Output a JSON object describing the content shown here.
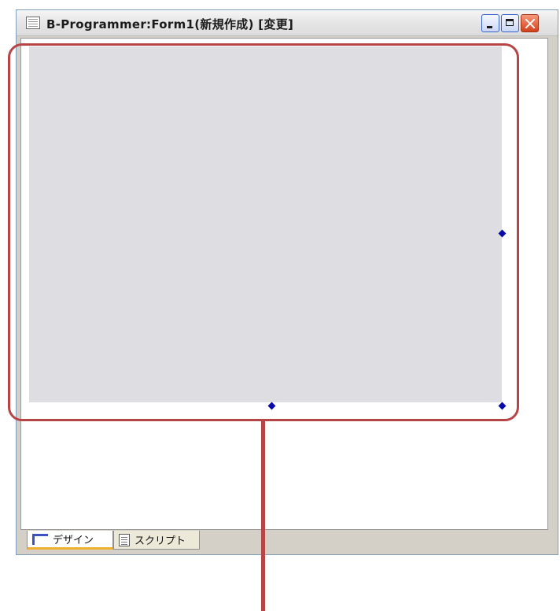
{
  "window": {
    "title": "B-Programmer:Form1(新規作成) [変更]",
    "controls": [
      "minimize",
      "maximize",
      "close"
    ]
  },
  "icons": {
    "app": "app-document-icon",
    "design_tab": "design-icon",
    "script_tab": "script-document-icon"
  },
  "tabs": [
    {
      "label": "デザイン",
      "selected": true
    },
    {
      "label": "スクリプト",
      "selected": false
    }
  ],
  "colors": {
    "form_background": "#dedde2",
    "selection_handle": "#0a0aa8",
    "callout": "#b74545",
    "active_tab_accent": "#f0b030"
  }
}
